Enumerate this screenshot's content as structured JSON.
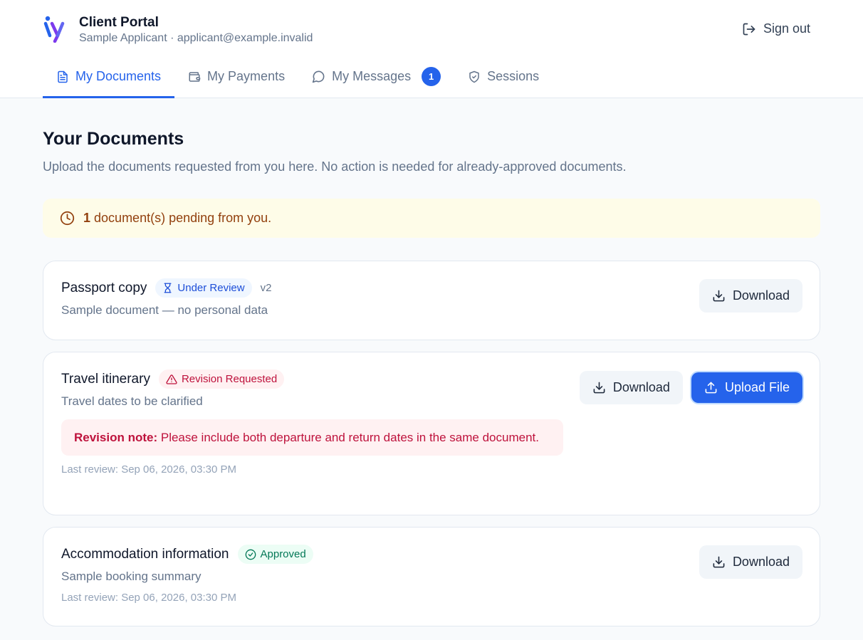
{
  "app": {
    "title": "Client Portal",
    "user_line": "Sample Applicant · applicant@example.invalid",
    "signout_label": "Sign out",
    "accent": "#2563eb"
  },
  "tabs": [
    {
      "label": "My Documents",
      "icon": "document-icon",
      "active": true
    },
    {
      "label": "My Payments",
      "icon": "wallet-icon",
      "active": false
    },
    {
      "label": "My Messages",
      "icon": "message-icon",
      "active": false,
      "badge": "1"
    },
    {
      "label": "Sessions",
      "icon": "shield-icon",
      "active": false
    }
  ],
  "main": {
    "title": "Your Documents",
    "description": "Upload the documents requested from you here. No action is needed for already-approved documents.",
    "alert": {
      "count": "1",
      "text": "document(s) pending from you."
    }
  },
  "documents": [
    {
      "title": "Passport copy",
      "status": "Under Review",
      "version": "v2",
      "description": "Sample document — no personal data",
      "download_label": "Download"
    },
    {
      "title": "Travel itinerary",
      "status": "Revision Requested",
      "description": "Travel dates to be clarified",
      "note_label": "Revision note:",
      "note_text": "Please include both departure and return dates in the same document.",
      "last_review": "Last review: Sep 06, 2026, 03:30 PM",
      "download_label": "Download",
      "upload_label": "Upload File"
    },
    {
      "title": "Accommodation information",
      "status": "Approved",
      "description": "Sample booking summary",
      "last_review": "Last review: Sep 06, 2026, 03:30 PM",
      "download_label": "Download"
    }
  ],
  "colors": {
    "review": "#1d4ed8",
    "revision": "#be123c",
    "approved": "#047857",
    "alert": "#92400e"
  }
}
